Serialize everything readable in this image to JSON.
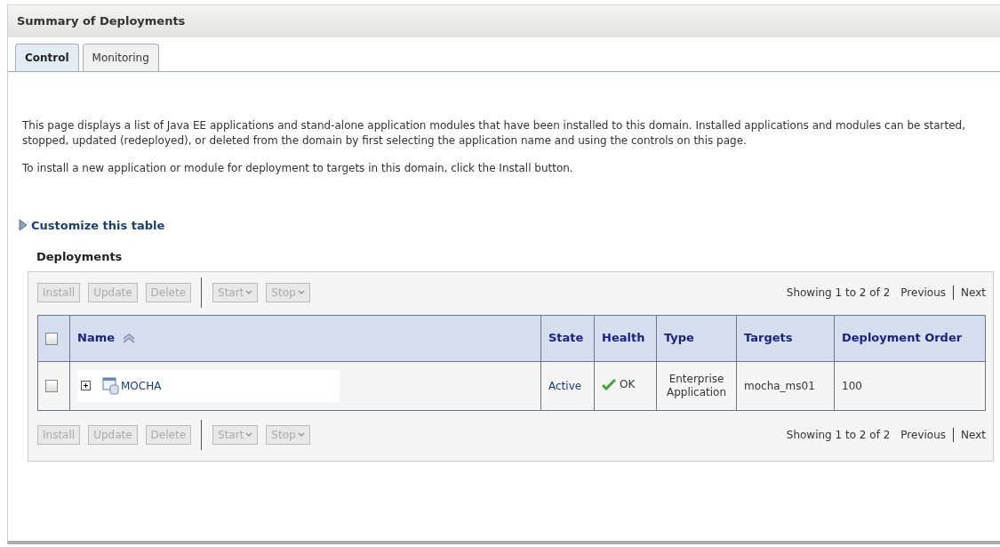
{
  "title": "Summary of Deployments",
  "tabs": [
    {
      "label": "Control",
      "selected": true
    },
    {
      "label": "Monitoring",
      "selected": false
    }
  ],
  "paragraphs": [
    "This page displays a list of Java EE applications and stand-alone application modules that have been installed to this domain. Installed applications and modules can be started, stopped, updated (redeployed), or deleted from the domain by first selecting the application name and using the controls on this page.",
    "To install a new application or module for deployment to targets in this domain, click the Install button."
  ],
  "customize_link": "Customize this table",
  "table_title": "Deployments",
  "toolbars": [
    {
      "buttons": [
        {
          "label": "Install",
          "kind": "plain",
          "disabled": true
        },
        {
          "label": "Update",
          "kind": "plain",
          "disabled": true
        },
        {
          "label": "Delete",
          "kind": "plain",
          "disabled": true
        },
        {
          "label": "Start",
          "kind": "menu",
          "disabled": true
        },
        {
          "label": "Stop",
          "kind": "menu",
          "disabled": true
        }
      ],
      "paging": "Showing 1 to 2 of 2",
      "previous": "Previous",
      "next": "Next"
    },
    {
      "buttons": [
        {
          "label": "Install",
          "kind": "plain",
          "disabled": true
        },
        {
          "label": "Update",
          "kind": "plain",
          "disabled": true
        },
        {
          "label": "Delete",
          "kind": "plain",
          "disabled": true
        },
        {
          "label": "Start",
          "kind": "menu",
          "disabled": true
        },
        {
          "label": "Stop",
          "kind": "menu",
          "disabled": true
        }
      ],
      "paging": "Showing 1 to 2 of 2",
      "previous": "Previous",
      "next": "Next"
    }
  ],
  "select_all_checked": false,
  "columns": [
    {
      "label": "Name",
      "sorted": true
    },
    {
      "label": "State",
      "sorted": false
    },
    {
      "label": "Health",
      "sorted": false
    },
    {
      "label": "Type",
      "sorted": false
    },
    {
      "label": "Targets",
      "sorted": false
    },
    {
      "label": "Deployment Order",
      "sorted": false
    }
  ],
  "rows": [
    {
      "checked": false,
      "expanded": false,
      "name": "MOCHA",
      "state": "Active",
      "health": "OK",
      "type": "Enterprise Application",
      "targets": "mocha_ms01",
      "order": "100"
    }
  ]
}
